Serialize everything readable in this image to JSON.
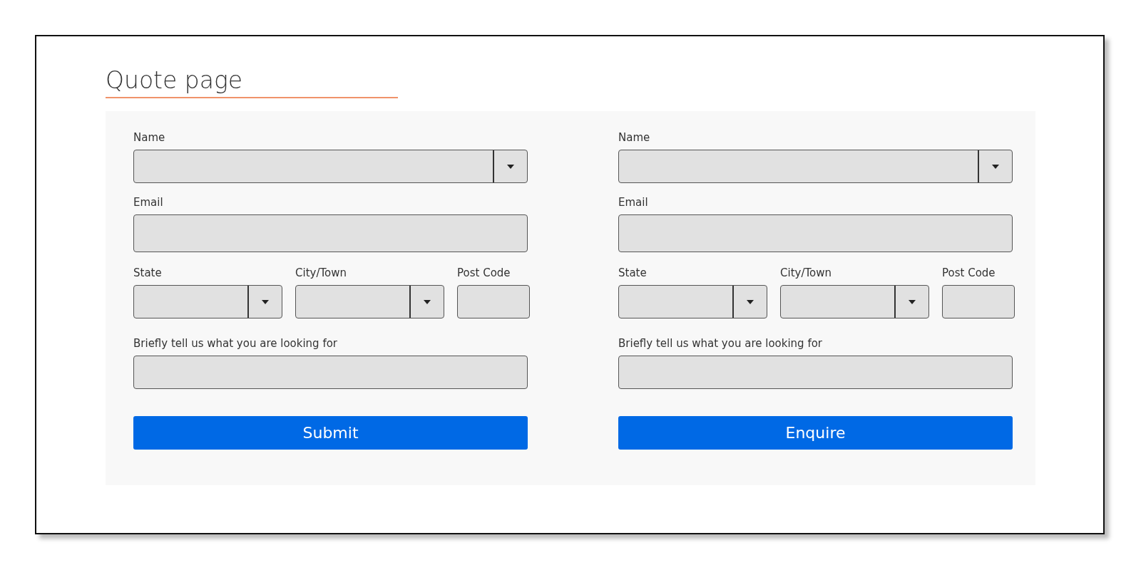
{
  "title": "Quote page",
  "forms": [
    {
      "name": {
        "label": "Name"
      },
      "email": {
        "label": "Email"
      },
      "state": {
        "label": "State"
      },
      "city": {
        "label": "City/Town"
      },
      "post_code": {
        "label": "Post Code"
      },
      "message": {
        "label": "Briefly tell us what you are looking for"
      },
      "button": "Submit"
    },
    {
      "name": {
        "label": "Name"
      },
      "email": {
        "label": "Email"
      },
      "state": {
        "label": "State"
      },
      "city": {
        "label": "City/Town"
      },
      "post_code": {
        "label": "Post Code"
      },
      "message": {
        "label": "Briefly tell us what you are looking for"
      },
      "button": "Enquire"
    }
  ]
}
